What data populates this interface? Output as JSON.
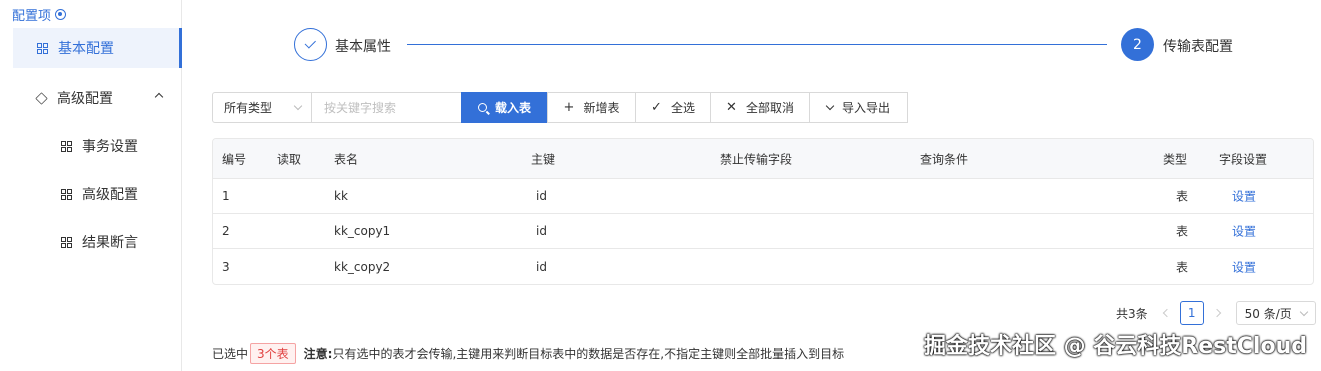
{
  "sidebar": {
    "title": "配置项",
    "items": [
      {
        "label": "基本配置",
        "icon": "grid-icon",
        "active": true
      },
      {
        "label": "高级配置",
        "icon": "cube-icon",
        "expanded": true
      },
      {
        "label": "事务设置",
        "icon": "grid-icon"
      },
      {
        "label": "高级配置",
        "icon": "grid-icon"
      },
      {
        "label": "结果断言",
        "icon": "grid-icon"
      }
    ]
  },
  "steps": [
    {
      "label": "基本属性",
      "status": "done"
    },
    {
      "number": "2",
      "label": "传输表配置",
      "status": "current"
    }
  ],
  "toolbar": {
    "type_select": "所有类型",
    "search_placeholder": "按关键字搜索",
    "load_label": "载入表",
    "add_label": "新增表",
    "select_all_label": "全选",
    "cancel_all_label": "全部取消",
    "import_export_label": "导入导出"
  },
  "table": {
    "columns": [
      "编号",
      "读取",
      "表名",
      "主键",
      "禁止传输字段",
      "查询条件",
      "类型",
      "字段设置"
    ],
    "rows": [
      {
        "no": "1",
        "read": true,
        "name": "kk",
        "pk": "id",
        "type": "表",
        "setting": "设置"
      },
      {
        "no": "2",
        "read": true,
        "name": "kk_copy1",
        "pk": "id",
        "type": "表",
        "setting": "设置"
      },
      {
        "no": "3",
        "read": true,
        "name": "kk_copy2",
        "pk": "id",
        "type": "表",
        "setting": "设置"
      }
    ]
  },
  "pagination": {
    "total": "共3条",
    "current": "1",
    "page_size": "50 条/页"
  },
  "footer": {
    "selected_prefix": "已选中",
    "selected_count": "3个表",
    "note_label": "注意:",
    "note_text": "只有选中的表才会传输,主键用来判断目标表中的数据是否存在,不指定主键则全部批量插入到目标"
  },
  "watermark": "掘金技术社区 @ 谷云科技RestCloud",
  "colors": {
    "accent": "#3370d8",
    "badge": "#e04040"
  }
}
